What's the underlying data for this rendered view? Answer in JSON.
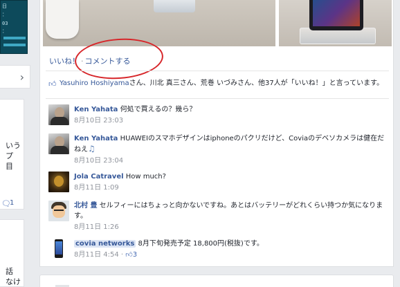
{
  "left": {
    "calendar_rows": [
      "日",
      "：",
      "03",
      "："
    ],
    "chevron": "›",
    "card_text": [
      "いう",
      "プ",
      "目"
    ],
    "comment_count": "1",
    "card2_text": [
      "話",
      "なけ"
    ]
  },
  "post": {
    "actions": {
      "like": "いいね！",
      "separator": "·",
      "comment": "コメントする"
    },
    "likes": {
      "names": "Yasuhiro Hoshiyama",
      "text_suffix": "さん、川北 真三さん、荒巻 いづみさん、他37人が「いいね！」と言っています。"
    },
    "comments": [
      {
        "author": "Ken Yahata",
        "text": "何処で買えるの？幾ら？",
        "time": "8月10日 23:03",
        "avatar": "ken-avatar"
      },
      {
        "author": "Ken Yahata",
        "text": "HUAWEIのスマホデザインはiphoneのパクリだけど、Coviaのデベソカメラは健在だねえ",
        "time": "8月10日 23:04",
        "avatar": "ken-avatar"
      },
      {
        "author": "Jola Catravel",
        "text": "How much?",
        "time": "8月11日 1:09",
        "avatar": "jola-avatar"
      },
      {
        "author": "北村 豊",
        "text": "セルフィーにはちょっと向かないですね。あとはバッテリーがどれくらい持つか気になります。",
        "time": "8月11日 1:26",
        "avatar": "kitamura-avatar"
      },
      {
        "author": "covia networks",
        "text": "8月下旬発売予定 18,800円(税抜)です。",
        "time": "8月11日 4:54",
        "meta_sep": "·",
        "like_count": "3",
        "avatar": "covia-avatar"
      }
    ]
  },
  "colors": {
    "link": "#365899",
    "annotation_circle": "#d7262a",
    "meta": "#90949c"
  }
}
